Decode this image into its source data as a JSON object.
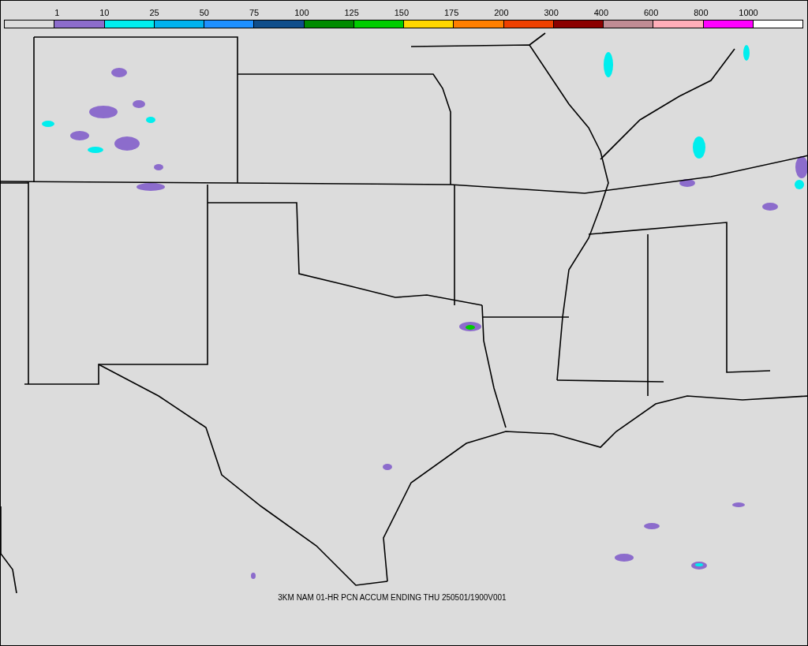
{
  "legend": {
    "labels": [
      "1",
      "10",
      "25",
      "50",
      "75",
      "100",
      "125",
      "150",
      "175",
      "200",
      "300",
      "400",
      "600",
      "800",
      "1000"
    ],
    "swatches": [
      {
        "color": "#dcdcdc"
      },
      {
        "color": "#8c6ccc"
      },
      {
        "color": "#00eeee"
      },
      {
        "color": "#00b2ee"
      },
      {
        "color": "#1e90ff"
      },
      {
        "color": "#104e8b"
      },
      {
        "color": "#008b00"
      },
      {
        "color": "#00cd00"
      },
      {
        "color": "#ffd700"
      },
      {
        "color": "#ff7f00"
      },
      {
        "color": "#ee4000"
      },
      {
        "color": "#8b0000"
      },
      {
        "color": "#c08c94"
      },
      {
        "color": "#ffaeb9"
      },
      {
        "color": "#ff00ff"
      },
      {
        "color": "#ffffff"
      }
    ]
  },
  "caption": "3KM NAM 01-HR PCN ACCUM ENDING THU 250501/1900V001"
}
